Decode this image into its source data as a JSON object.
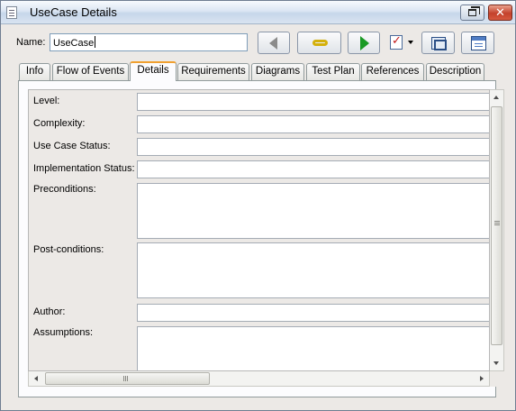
{
  "window": {
    "title": "UseCase Details",
    "restore_label": "",
    "close_label": "✕"
  },
  "name_row": {
    "label": "Name:",
    "value": "UseCase"
  },
  "toolbar": {
    "icons": [
      "back-arrow-icon",
      "link-icon",
      "forward-arrow-icon",
      "checklist-dropdown-icon",
      "maximize-icon",
      "window-icon"
    ]
  },
  "tabs": [
    {
      "label": "Info"
    },
    {
      "label": "Flow of Events"
    },
    {
      "label": "Details",
      "active": true
    },
    {
      "label": "Requirements"
    },
    {
      "label": "Diagrams"
    },
    {
      "label": "Test Plan"
    },
    {
      "label": "References"
    },
    {
      "label": "Description"
    }
  ],
  "fields": {
    "level": {
      "label": "Level:",
      "value": ""
    },
    "complexity": {
      "label": "Complexity:",
      "value": ""
    },
    "status": {
      "label": "Use Case Status:",
      "value": ""
    },
    "implementation": {
      "label": "Implementation Status:",
      "value": ""
    },
    "preconditions": {
      "label": "Preconditions:",
      "value": ""
    },
    "postconditions": {
      "label": "Post-conditions:",
      "value": ""
    },
    "author": {
      "label": "Author:",
      "value": ""
    },
    "assumptions": {
      "label": "Assumptions:",
      "value": ""
    }
  },
  "colors": {
    "active_tab_accent": "#f0a030",
    "forward_arrow": "#1a9a25",
    "close_button": "#c4412b"
  }
}
